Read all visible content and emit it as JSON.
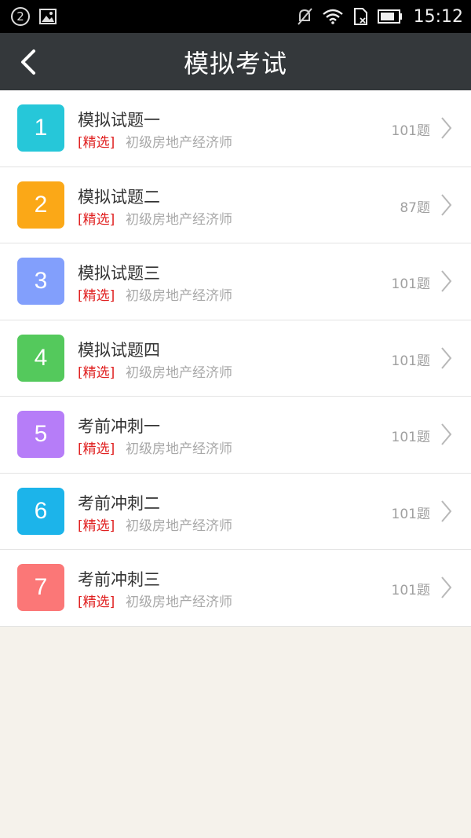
{
  "status_bar": {
    "notification_count": "2",
    "time": "15:12",
    "icons": [
      "image-icon",
      "mute-icon",
      "wifi-icon",
      "sim-icon",
      "battery-icon"
    ]
  },
  "app_bar": {
    "title": "模拟考试",
    "back_icon": "chevron-left-icon"
  },
  "colors": {
    "status_bar_bg": "#000000",
    "app_bar_bg": "#34383b",
    "page_bg": "#f5f2eb",
    "tag_red": "#e02020"
  },
  "exams": [
    {
      "number": "1",
      "title": "模拟试题一",
      "tag": "[精选]",
      "subtitle": "初级房地产经济师",
      "count": "101题",
      "color": "#26c7d9"
    },
    {
      "number": "2",
      "title": "模拟试题二",
      "tag": "[精选]",
      "subtitle": "初级房地产经济师",
      "count": "87题",
      "color": "#fba817"
    },
    {
      "number": "3",
      "title": "模拟试题三",
      "tag": "[精选]",
      "subtitle": "初级房地产经济师",
      "count": "101题",
      "color": "#829ffc"
    },
    {
      "number": "4",
      "title": "模拟试题四",
      "tag": "[精选]",
      "subtitle": "初级房地产经济师",
      "count": "101题",
      "color": "#54c95c"
    },
    {
      "number": "5",
      "title": "考前冲刺一",
      "tag": "[精选]",
      "subtitle": "初级房地产经济师",
      "count": "101题",
      "color": "#b67df8"
    },
    {
      "number": "6",
      "title": "考前冲刺二",
      "tag": "[精选]",
      "subtitle": "初级房地产经济师",
      "count": "101题",
      "color": "#1cb4ea"
    },
    {
      "number": "7",
      "title": "考前冲刺三",
      "tag": "[精选]",
      "subtitle": "初级房地产经济师",
      "count": "101题",
      "color": "#fb7777"
    }
  ]
}
